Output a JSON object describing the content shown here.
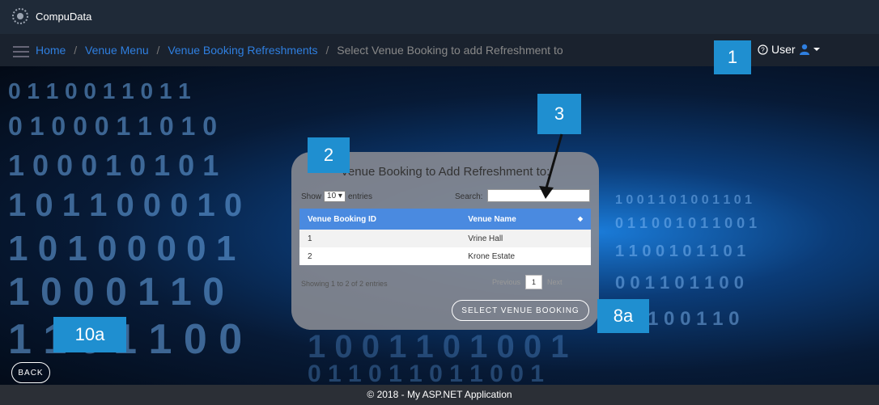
{
  "app": {
    "brand": "CompuData"
  },
  "breadcrumb": [
    {
      "label": "Home",
      "link": true
    },
    {
      "label": "Venue Menu",
      "link": true
    },
    {
      "label": "Venue Booking Refreshments",
      "link": true
    },
    {
      "label": "Select Venue Booking to add Refreshment to",
      "link": false
    }
  ],
  "user_menu": {
    "label": "User",
    "help_icon": "question-circle-icon",
    "person_icon": "user-icon",
    "caret": "caret-down-icon"
  },
  "panel": {
    "title": "Venue Booking to Add Refreshment to:",
    "length_prefix": "Show",
    "length_value": "10",
    "length_suffix": "entries",
    "search_label": "Search:",
    "search_value": "",
    "columns": [
      "Venue Booking ID",
      "Venue Name"
    ],
    "rows": [
      {
        "id": "1",
        "name": "Vrine Hall"
      },
      {
        "id": "2",
        "name": "Krone Estate"
      }
    ],
    "info": "Showing 1 to 2 of 2 entries",
    "pager": {
      "previous": "Previous",
      "current": "1",
      "next": "Next"
    },
    "select_button": "SELECT VENUE BOOKING"
  },
  "back_button": "BACK",
  "footer": "© 2018 - My ASP.NET Application",
  "callouts": {
    "c1": "1",
    "c2": "2",
    "c3": "3",
    "c8a": "8a",
    "c10a": "10a"
  },
  "colors": {
    "accent": "#1f8fd0",
    "link": "#2f7fe0",
    "table_header": "#4a8ae0"
  }
}
